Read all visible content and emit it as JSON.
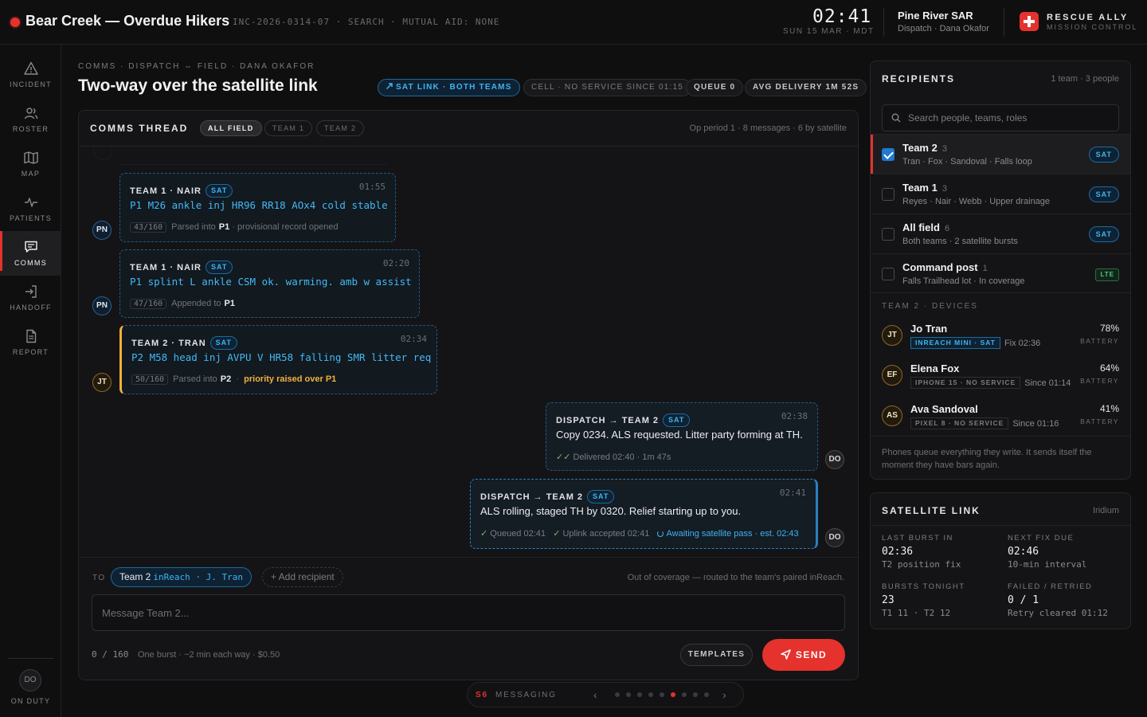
{
  "incident": {
    "title": "Bear Creek — Overdue Hikers",
    "meta": "INC-2026-0314-07 · SEARCH · MUTUAL AID: NONE"
  },
  "clock": {
    "time": "02:41",
    "date": "SUN 15 MAR · MDT"
  },
  "org": {
    "name": "Pine River SAR",
    "sub": "Dispatch · Dana Okafor"
  },
  "brand": {
    "name": "RESCUE ALLY",
    "sub": "MISSION CONTROL",
    "accent": "#e5322d"
  },
  "sidebar": {
    "items": [
      {
        "label": "INCIDENT",
        "icon": "alert-triangle-icon"
      },
      {
        "label": "ROSTER",
        "icon": "users-icon"
      },
      {
        "label": "MAP",
        "icon": "map-icon"
      },
      {
        "label": "PATIENTS",
        "icon": "pulse-icon"
      },
      {
        "label": "COMMS",
        "icon": "message-icon",
        "active": true
      },
      {
        "label": "HANDOFF",
        "icon": "login-arrow-icon"
      },
      {
        "label": "REPORT",
        "icon": "document-icon"
      }
    ],
    "user_initials": "DO",
    "user_status": "ON DUTY"
  },
  "header": {
    "breadcrumb": "COMMS · DISPATCH ⇔ FIELD · DANA OKAFOR",
    "title": "Two-way over the satellite link",
    "pills": {
      "sat": "SAT LINK · BOTH TEAMS",
      "cell": "CELL · NO SERVICE SINCE 01:15",
      "queue": "QUEUE 0",
      "avg": "AVG DELIVERY 1M 52S"
    }
  },
  "thread": {
    "title": "COMMS THREAD",
    "tabs": [
      "ALL FIELD",
      "TEAM 1",
      "TEAM 2"
    ],
    "active_tab": "ALL FIELD",
    "meta": "Op period 1 · 8 messages · 6 by satellite",
    "ghost_initials": "JT",
    "messages": [
      {
        "initials": "PN",
        "from": "TEAM 1 · NAIR",
        "tag": "SAT",
        "time": "01:55",
        "text": "P1 M26 ankle inj HR96 RR18 AOx4 cold stable",
        "count": "43/160",
        "note": "Parsed into",
        "patient": "P1",
        "extra": "· provisional record opened"
      },
      {
        "initials": "PN",
        "from": "TEAM 1 · NAIR",
        "tag": "SAT",
        "time": "02:20",
        "text": "P1 splint L ankle CSM ok. warming. amb w assist",
        "count": "47/160",
        "note": "Appended to",
        "patient": "P1"
      },
      {
        "initials": "JT",
        "from": "TEAM 2 · TRAN",
        "tag": "SAT",
        "time": "02:34",
        "text": "P2 M58 head inj AVPU V HR58 falling SMR litter req",
        "count": "50/160",
        "note": "Parsed into",
        "patient": "P2",
        "extra": "priority raised over P1"
      },
      {
        "initials": "DO",
        "from": "DISPATCH → TEAM 2",
        "tag": "SAT",
        "time": "02:38",
        "text": "Copy 0234. ALS requested. Litter party forming at TH.",
        "status": "Delivered 02:40 · 1m 47s"
      },
      {
        "initials": "DO",
        "from": "DISPATCH → TEAM 2",
        "tag": "SAT",
        "time": "02:41",
        "text": "ALS rolling, staged TH by 0320. Relief starting up to you.",
        "queued": "Queued 02:41",
        "uplink": "Uplink accepted 02:41",
        "awaiting": "Awaiting satellite pass · est. 02:43"
      }
    ]
  },
  "composer": {
    "to_label": "TO",
    "to_team": "Team 2",
    "to_device": "inReach · J. Tran",
    "add_recipient": "+ Add recipient",
    "route_note": "Out of coverage — routed to the team's paired inReach.",
    "placeholder": "Message Team 2...",
    "char_count": "0 / 160",
    "char_note": "One burst · ~2 min each way · $0.50",
    "templates": "TEMPLATES",
    "send": "SEND"
  },
  "pager": {
    "step": "S6",
    "label": "MESSAGING",
    "total": 9,
    "current": 6
  },
  "recipients": {
    "title": "RECIPIENTS",
    "meta": "1 team · 3 people",
    "search_placeholder": "Search people, teams, roles",
    "rows": [
      {
        "name": "Team 2",
        "count": "3",
        "sub": "Tran · Fox · Sandoval  ·  Falls loop",
        "tag": "SAT",
        "checked": true
      },
      {
        "name": "Team 1",
        "count": "3",
        "sub": "Reyes · Nair · Webb  ·  Upper drainage",
        "tag": "SAT",
        "checked": false
      },
      {
        "name": "All field",
        "count": "6",
        "sub": "Both teams  ·  2 satellite bursts",
        "tag": "SAT",
        "checked": false
      },
      {
        "name": "Command post",
        "count": "1",
        "sub": "Falls Trailhead lot  ·  In coverage",
        "tag": "LTE",
        "checked": false
      }
    ],
    "devices_label": "TEAM 2 · DEVICES",
    "devices": [
      {
        "initials": "JT",
        "name": "Jo Tran",
        "device": "INREACH MINI · SAT",
        "status": "Fix 02:36",
        "battery": "78%",
        "sat": true
      },
      {
        "initials": "EF",
        "name": "Elena Fox",
        "device": "IPHONE 15 · NO SERVICE",
        "status": "Since 01:14",
        "battery": "64%",
        "sat": false
      },
      {
        "initials": "AS",
        "name": "Ava Sandoval",
        "device": "PIXEL 8 · NO SERVICE",
        "status": "Since 01:16",
        "battery": "41%",
        "sat": false
      }
    ],
    "battery_label": "BATTERY",
    "note": "Phones queue everything they write. It sends itself the moment they have bars again."
  },
  "satellite": {
    "title": "SATELLITE LINK",
    "provider": "Iridium",
    "stats": [
      {
        "label": "LAST BURST IN",
        "value": "02:36",
        "sub": "T2 position fix"
      },
      {
        "label": "NEXT FIX DUE",
        "value": "02:46",
        "sub": "10-min interval"
      },
      {
        "label": "BURSTS TONIGHT",
        "value": "23",
        "sub": "T1 11 · T2 12"
      },
      {
        "label": "FAILED / RETRIED",
        "value": "0 / 1",
        "sub": "Retry cleared 01:12"
      }
    ]
  }
}
